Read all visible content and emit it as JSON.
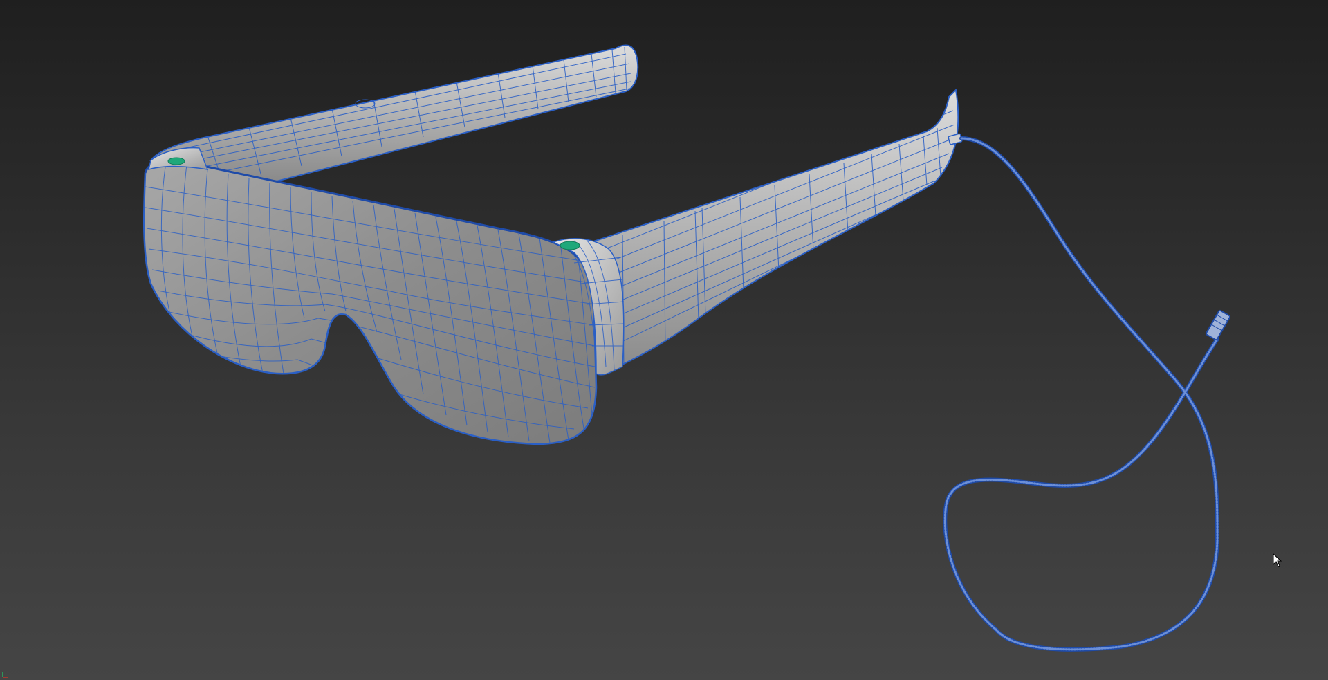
{
  "viewport": {
    "background_top": "#1f1f1f",
    "background_bottom": "#454545",
    "wire_color": "#2a5fc6",
    "shade_light": "#c4c4c4",
    "shade_dark": "#7a7a7a",
    "button_color": "#1fa87a"
  },
  "model": {
    "parts": [
      "front-visor",
      "left-temple-arm",
      "right-temple-arm",
      "usb-cable",
      "cable-connector",
      "left-button",
      "right-button"
    ]
  },
  "icons": {
    "axis": "axis-gizmo-icon",
    "cursor": "mouse-pointer-icon"
  }
}
